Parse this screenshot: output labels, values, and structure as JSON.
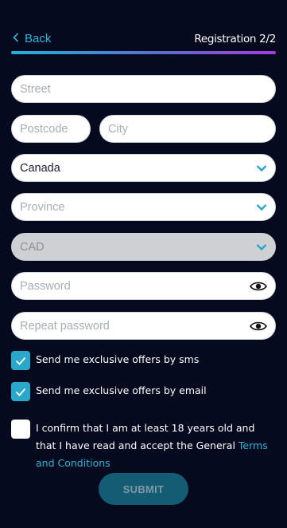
{
  "header": {
    "back_label": "Back",
    "title": "Registration 2/2"
  },
  "form": {
    "street": {
      "placeholder": "Street",
      "value": ""
    },
    "postcode": {
      "placeholder": "Postcode",
      "value": ""
    },
    "city": {
      "placeholder": "City",
      "value": ""
    },
    "country": {
      "value": "Canada"
    },
    "province": {
      "placeholder": "Province"
    },
    "currency": {
      "value": "CAD",
      "disabled": true
    },
    "password": {
      "placeholder": "Password"
    },
    "repeat_password": {
      "placeholder": "Repeat password"
    }
  },
  "checkboxes": {
    "sms": {
      "label": "Send me exclusive offers by sms",
      "checked": true
    },
    "email": {
      "label": "Send me exclusive offers by email",
      "checked": true
    },
    "terms": {
      "label_prefix": "I confirm that I am at least 18 years old and that I have read and accept the General ",
      "link_text": "Terms and Conditions",
      "checked": false
    }
  },
  "submit_label": "SUBMIT",
  "colors": {
    "background": "#050a1f",
    "accent": "#2fb5d6",
    "gradient_start": "#21b3d8",
    "gradient_end": "#a63bdc",
    "submit_bg": "#145c74"
  },
  "icons": {
    "back": "chevron-left-icon",
    "dropdown": "chevron-down-icon",
    "password_toggle": "eye-icon",
    "check": "check-icon"
  }
}
